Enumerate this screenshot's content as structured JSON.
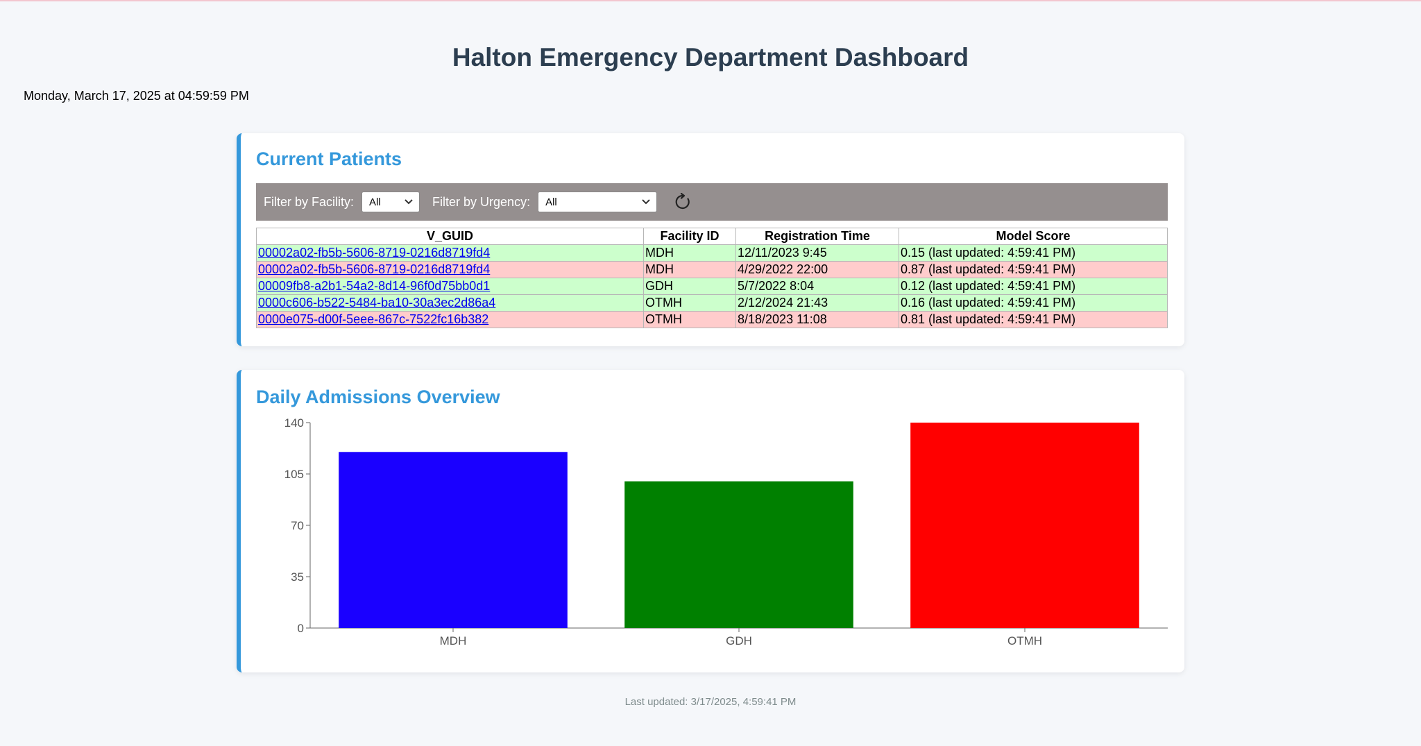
{
  "header": {
    "title": "Halton Emergency Department Dashboard",
    "datetime": "Monday, March 17, 2025 at 04:59:59 PM"
  },
  "patients": {
    "title": "Current Patients",
    "filters": {
      "facility_label": "Filter by Facility:",
      "facility_value": "All",
      "urgency_label": "Filter by Urgency:",
      "urgency_value": "All"
    },
    "columns": [
      "V_GUID",
      "Facility ID",
      "Registration Time",
      "Model Score"
    ],
    "rows": [
      {
        "guid": "00002a02-fb5b-5606-8719-0216d8719fd4",
        "facility": "MDH",
        "reg_time": "12/11/2023 9:45",
        "score": "0.15 (last updated: 4:59:41 PM)",
        "level": "low"
      },
      {
        "guid": "00002a02-fb5b-5606-8719-0216d8719fd4",
        "facility": "MDH",
        "reg_time": "4/29/2022 22:00",
        "score": "0.87 (last updated: 4:59:41 PM)",
        "level": "high"
      },
      {
        "guid": "00009fb8-a2b1-54a2-8d14-96f0d75bb0d1",
        "facility": "GDH",
        "reg_time": "5/7/2022 8:04",
        "score": "0.12 (last updated: 4:59:41 PM)",
        "level": "low"
      },
      {
        "guid": "0000c606-b522-5484-ba10-30a3ec2d86a4",
        "facility": "OTMH",
        "reg_time": "2/12/2024 21:43",
        "score": "0.16 (last updated: 4:59:41 PM)",
        "level": "low"
      },
      {
        "guid": "0000e075-d00f-5eee-867c-7522fc16b382",
        "facility": "OTMH",
        "reg_time": "8/18/2023 11:08",
        "score": "0.81 (last updated: 4:59:41 PM)",
        "level": "high"
      }
    ],
    "row_colors": {
      "low": "#ccffcc",
      "high": "#ffcccc"
    }
  },
  "admissions": {
    "title": "Daily Admissions Overview"
  },
  "chart_data": {
    "type": "bar",
    "categories": [
      "MDH",
      "GDH",
      "OTMH"
    ],
    "values": [
      120,
      100,
      140
    ],
    "colors": [
      "#1a00ff",
      "#008000",
      "#ff0000"
    ],
    "ylim": [
      0,
      140
    ],
    "yticks": [
      0,
      35,
      70,
      105,
      140
    ],
    "grid": false,
    "title": "",
    "xlabel": "",
    "ylabel": ""
  },
  "footer": {
    "last_updated": "Last updated: 3/17/2025, 4:59:41 PM"
  },
  "icons": {
    "refresh": "refresh-icon",
    "dropdown": "chevron-down-icon"
  },
  "theme": {
    "accent": "#3498db",
    "title_color": "#2c3e50",
    "filter_bar": "#958f8f"
  }
}
